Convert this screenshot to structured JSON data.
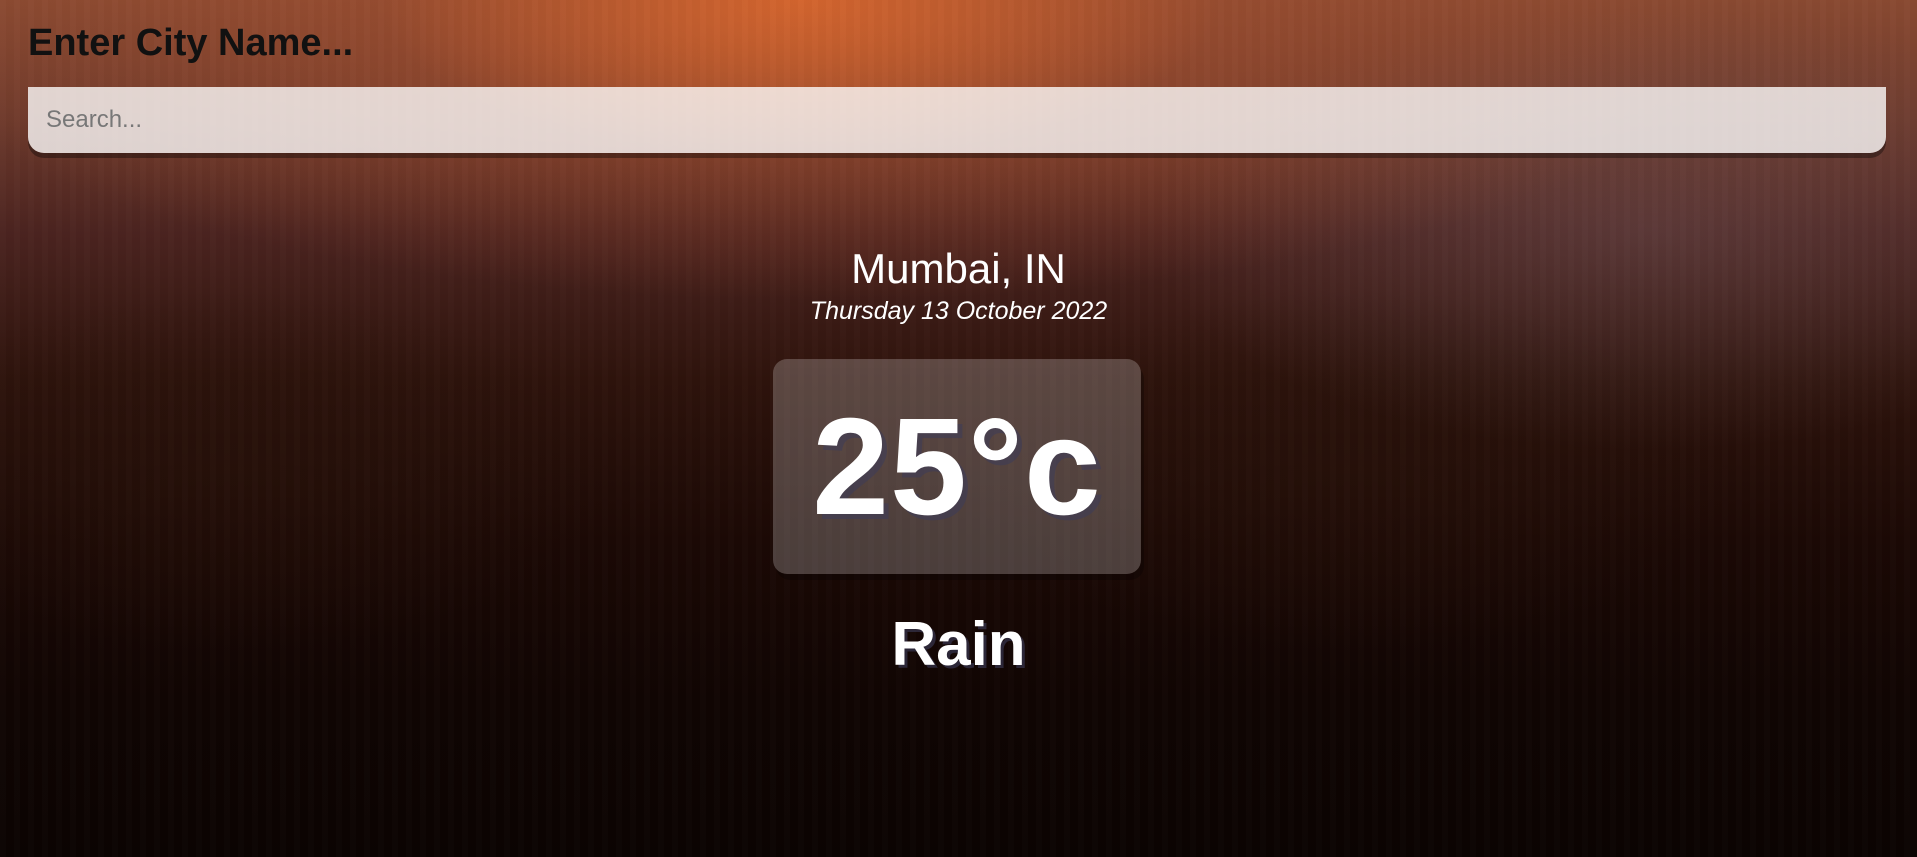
{
  "search": {
    "label": "Enter City Name...",
    "placeholder": "Search...",
    "value": ""
  },
  "location": {
    "city": "Mumbai, IN",
    "date": "Thursday 13 October 2022"
  },
  "weather": {
    "temperature": "25°c",
    "condition": "Rain"
  },
  "colors": {
    "sky_accent": "#d6662e",
    "text": "#ffffff",
    "label_text": "#111111"
  }
}
